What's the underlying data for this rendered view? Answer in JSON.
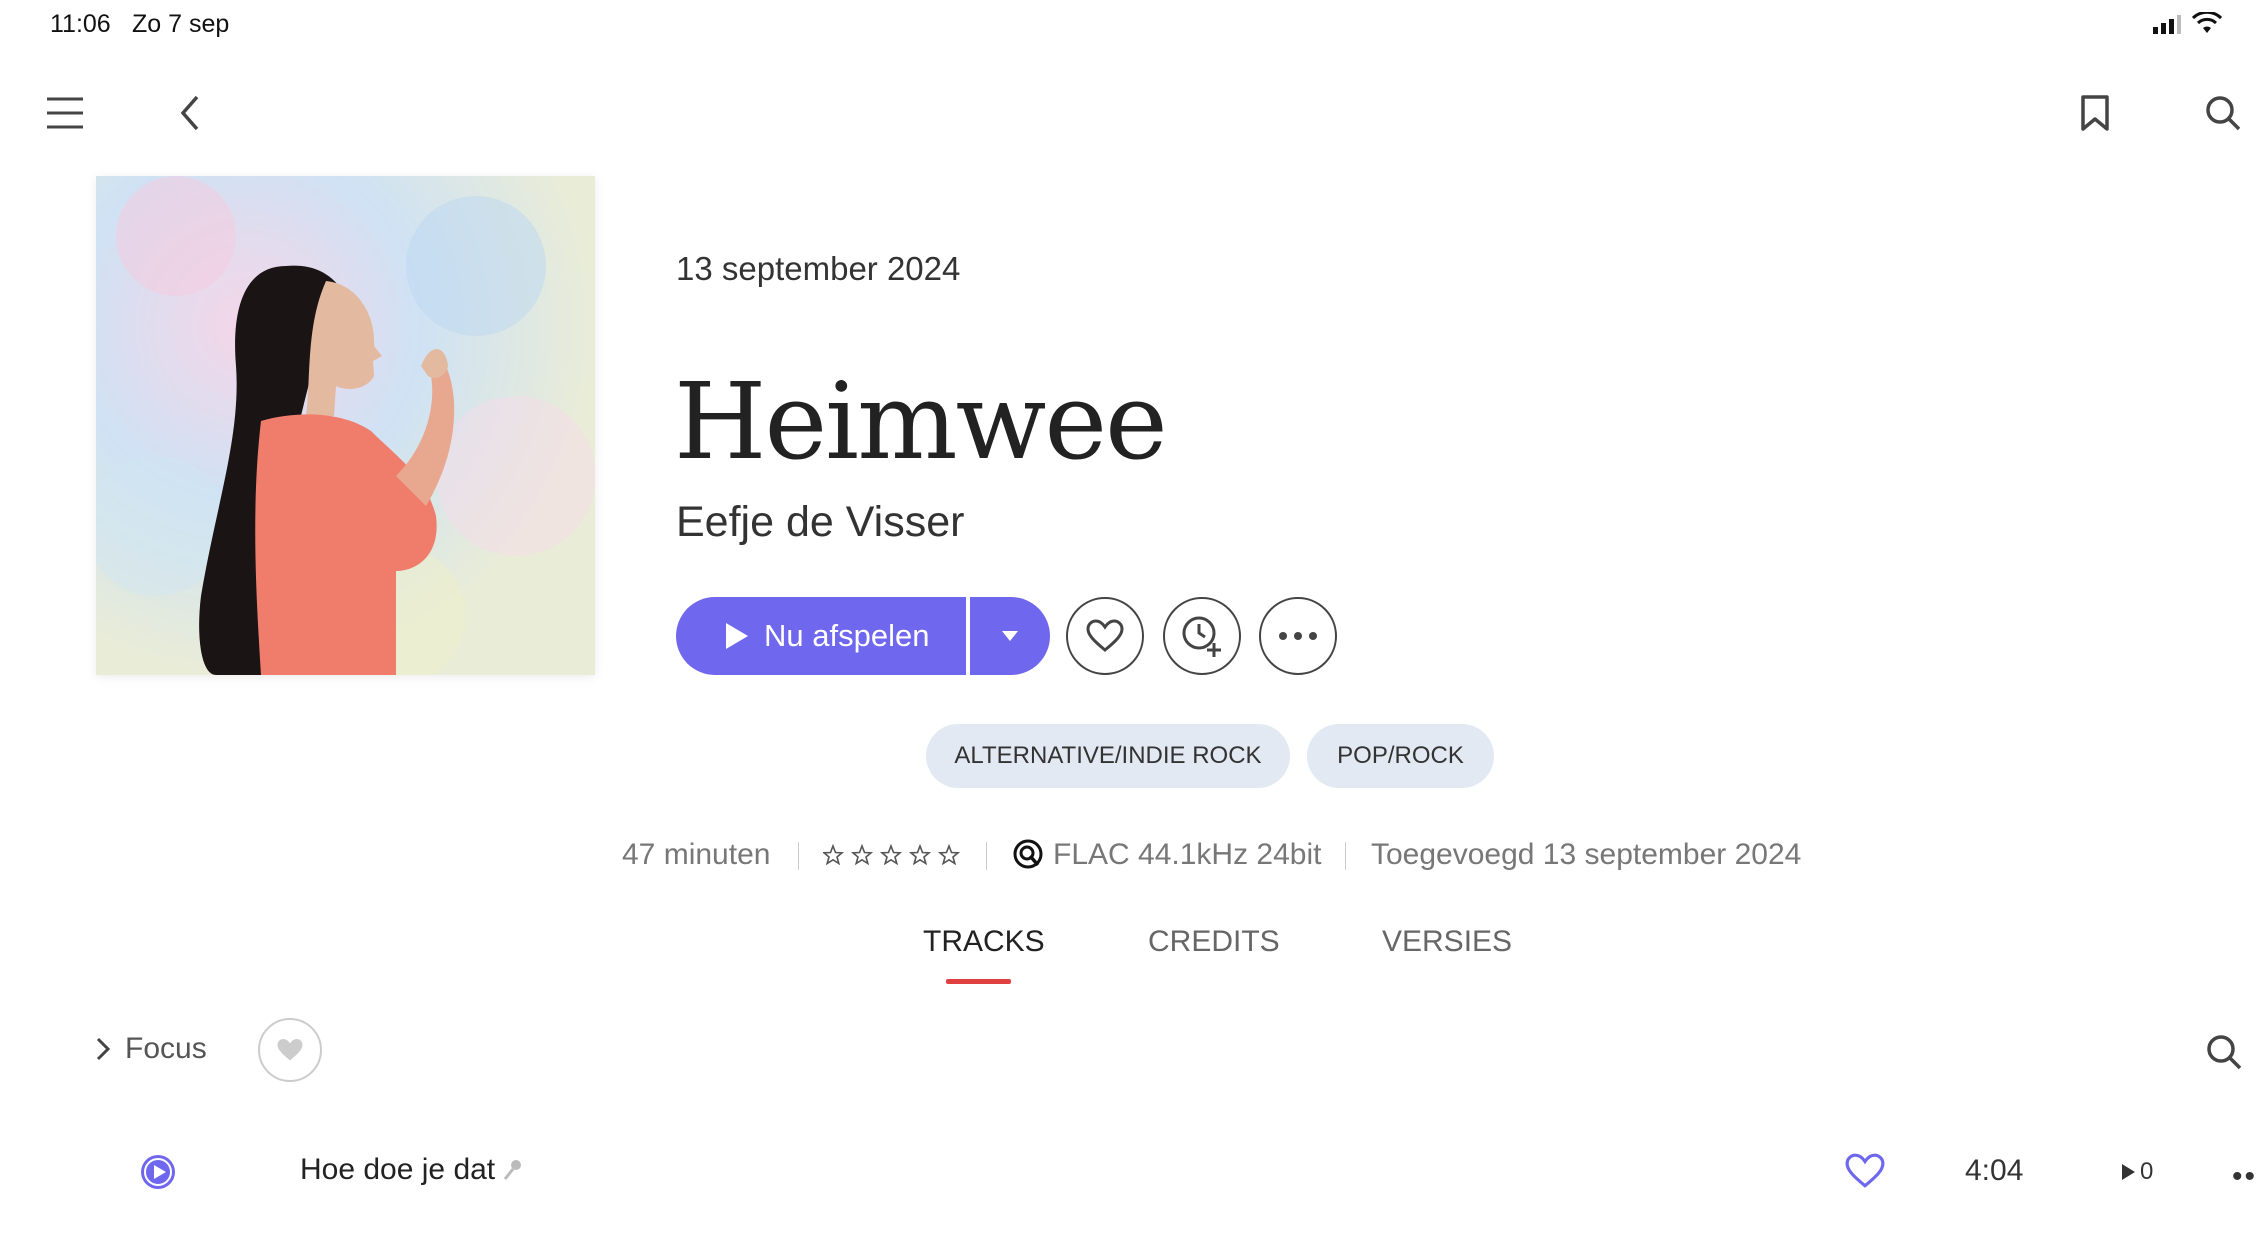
{
  "status_bar": {
    "time": "11:06",
    "date": "Zo 7 sep"
  },
  "album": {
    "release_date": "13 september 2024",
    "title": "Heimwee",
    "artist": "Eefje de Visser"
  },
  "actions": {
    "play_label": "Nu afspelen"
  },
  "genres": [
    "ALTERNATIVE/INDIE ROCK",
    "POP/ROCK"
  ],
  "meta": {
    "duration": "47 minuten",
    "rating_stars": 0,
    "quality": "FLAC 44.1kHz 24bit",
    "added": "Toegevoegd 13 september 2024"
  },
  "tabs": [
    {
      "label": "TRACKS",
      "active": true
    },
    {
      "label": "CREDITS",
      "active": false
    },
    {
      "label": "VERSIES",
      "active": false
    }
  ],
  "focus": {
    "label": "Focus"
  },
  "tracks": [
    {
      "title": "Hoe doe je dat",
      "duration": "4:04",
      "plays": "0"
    }
  ],
  "colors": {
    "accent": "#6f67ee",
    "tab_underline": "#e04040",
    "chip_bg": "#e3e9f2"
  }
}
